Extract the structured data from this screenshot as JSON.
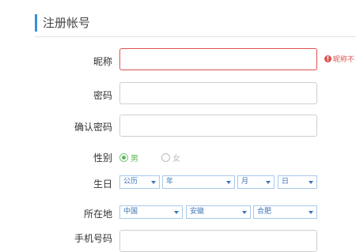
{
  "header": {
    "title": "注册帐号"
  },
  "form": {
    "nickname": {
      "label": "昵称",
      "value": "",
      "error": "昵称不"
    },
    "password": {
      "label": "密码",
      "value": ""
    },
    "confirm_password": {
      "label": "确认密码",
      "value": ""
    },
    "gender": {
      "label": "性别",
      "options": [
        "男",
        "女"
      ],
      "selected": "男"
    },
    "birthday": {
      "label": "生日",
      "calendar": "公历",
      "year": "年",
      "month": "月",
      "day": "日"
    },
    "location": {
      "label": "所在地",
      "country": "中国",
      "province": "安徽",
      "city": "合肥"
    },
    "phone": {
      "label": "手机号码"
    }
  },
  "colors": {
    "accent": "#3b8fd8",
    "error": "#d9534f",
    "radio_checked": "#5cb85c",
    "select_text": "#3b74b8"
  }
}
